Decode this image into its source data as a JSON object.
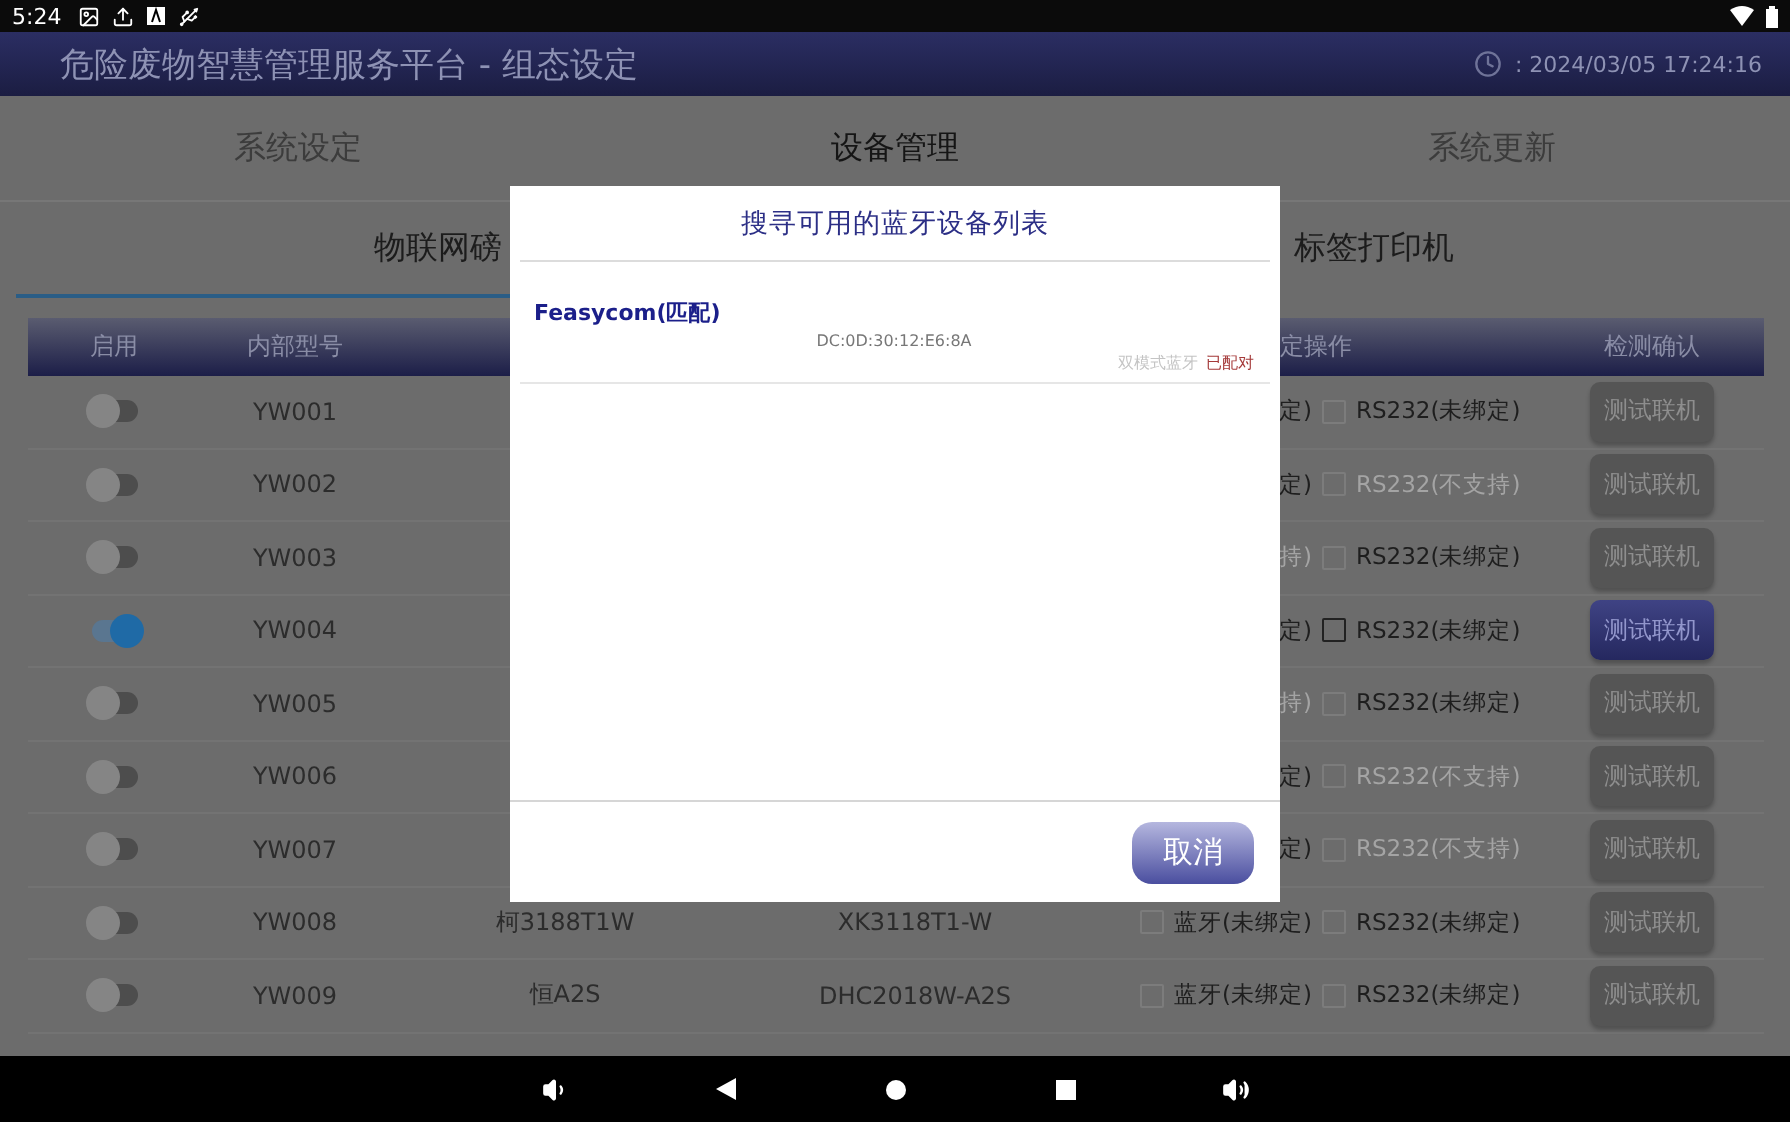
{
  "status_bar": {
    "time": "5:24"
  },
  "header": {
    "title": "危险废物智慧管理服务平台 - 组态设定",
    "datetime": ": 2024/03/05 17:24:16"
  },
  "top_tabs": [
    {
      "label": "系统设定",
      "selected": false
    },
    {
      "label": "设备管理",
      "selected": true
    },
    {
      "label": "系统更新",
      "selected": false
    }
  ],
  "sub_tabs": [
    {
      "label": "物联网磅",
      "selected": true
    },
    {
      "label": "标签打印机",
      "selected": false
    }
  ],
  "table": {
    "columns": [
      "启用",
      "内部型号",
      "定操作",
      "检测确认"
    ],
    "rows": [
      {
        "enabled": false,
        "code": "YW001",
        "column_3": "",
        "column_4": "",
        "bt": {
          "label": "定)",
          "disabled": false
        },
        "rs": {
          "label": "RS232(未绑定)",
          "checked": false,
          "disabled": false
        },
        "test": "测试联机"
      },
      {
        "enabled": false,
        "code": "YW002",
        "column_3": "",
        "column_4": "",
        "bt": {
          "label": "定)",
          "disabled": false
        },
        "rs": {
          "label": "RS232(不支持)",
          "checked": false,
          "disabled": true
        },
        "test": "测试联机"
      },
      {
        "enabled": false,
        "code": "YW003",
        "column_3": "",
        "column_4": "",
        "bt": {
          "label": "持)",
          "disabled": true
        },
        "rs": {
          "label": "RS232(未绑定)",
          "checked": false,
          "disabled": false
        },
        "test": "测试联机"
      },
      {
        "enabled": true,
        "code": "YW004",
        "column_3": "",
        "column_4": "",
        "bt": {
          "label": "定)",
          "disabled": false
        },
        "rs": {
          "label": "RS232(未绑定)",
          "checked": false,
          "disabled": false
        },
        "test": "测试联机"
      },
      {
        "enabled": false,
        "code": "YW005",
        "column_3": "",
        "column_4": "",
        "bt": {
          "label": "持)",
          "disabled": true
        },
        "rs": {
          "label": "RS232(未绑定)",
          "checked": false,
          "disabled": false
        },
        "test": "测试联机"
      },
      {
        "enabled": false,
        "code": "YW006",
        "column_3": "",
        "column_4": "",
        "bt": {
          "label": "定)",
          "disabled": false
        },
        "rs": {
          "label": "RS232(不支持)",
          "checked": false,
          "disabled": true
        },
        "test": "测试联机"
      },
      {
        "enabled": false,
        "code": "YW007",
        "column_3": "",
        "column_4": "",
        "bt": {
          "label": "定)",
          "disabled": false
        },
        "rs": {
          "label": "RS232(不支持)",
          "checked": false,
          "disabled": true
        },
        "test": "测试联机"
      },
      {
        "enabled": false,
        "code": "YW008",
        "column_3": "柯3188T1W",
        "column_4": "XK3118T1-W",
        "bt": {
          "label": "蓝牙(未绑定)",
          "checked": false,
          "disabled": false
        },
        "rs": {
          "label": "RS232(未绑定)",
          "checked": false,
          "disabled": false
        },
        "test": "测试联机"
      },
      {
        "enabled": false,
        "code": "YW009",
        "column_3": "恒A2S",
        "column_4": "DHC2018W-A2S",
        "bt": {
          "label": "蓝牙(未绑定)",
          "checked": false,
          "disabled": false
        },
        "rs": {
          "label": "RS232(未绑定)",
          "checked": false,
          "disabled": false
        },
        "test": "测试联机"
      }
    ]
  },
  "dialog": {
    "title": "搜寻可用的蓝牙设备列表",
    "devices": [
      {
        "name": "Feasycom(匹配)",
        "address": "DC:0D:30:12:E6:8A",
        "type": "双模式蓝牙",
        "status": "已配对"
      }
    ],
    "cancel": "取消"
  }
}
